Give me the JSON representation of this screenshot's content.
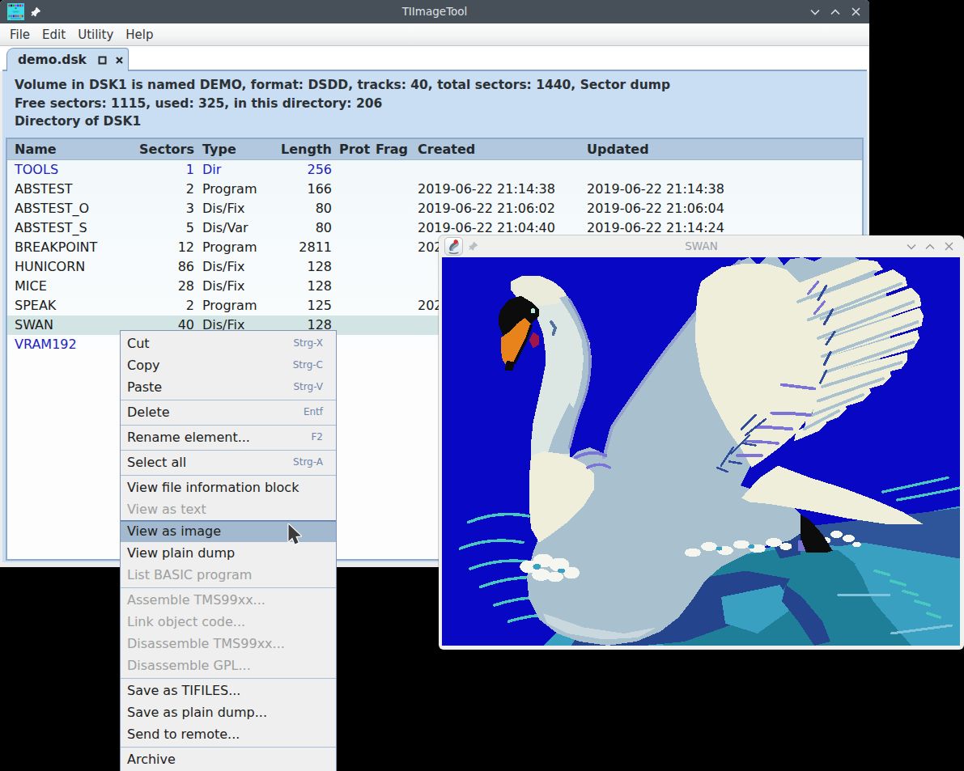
{
  "desktop": {
    "background": "#000000"
  },
  "main_window": {
    "title": "TIImageTool",
    "titlebar_controls": {
      "minimize": "v-chevron",
      "maximize": "^-chevron",
      "close": "x"
    },
    "menubar": {
      "items": [
        "File",
        "Edit",
        "Utility",
        "Help"
      ]
    },
    "tab": {
      "label": "demo.dsk",
      "detach_icon": "square-outline",
      "close_icon": "x"
    },
    "info_lines": [
      "Volume in DSK1 is named DEMO, format: DSDD, tracks: 40, total sectors: 1440, Sector dump",
      "Free sectors: 1115, used: 325, in this directory: 206",
      "Directory of DSK1"
    ],
    "table": {
      "columns": [
        "Name",
        "Sectors",
        "Type",
        "Length",
        "Prot",
        "Frag",
        "Created",
        "Updated"
      ],
      "rows": [
        {
          "name": "TOOLS",
          "sectors": "1",
          "type": "Dir",
          "length": "256",
          "prot": "",
          "frag": "",
          "created": "",
          "updated": "",
          "dir": true,
          "selected": false
        },
        {
          "name": "ABSTEST",
          "sectors": "2",
          "type": "Program",
          "length": "166",
          "prot": "",
          "frag": "",
          "created": "2019-06-22 21:14:38",
          "updated": "2019-06-22 21:14:38",
          "dir": false,
          "selected": false
        },
        {
          "name": "ABSTEST_O",
          "sectors": "3",
          "type": "Dis/Fix",
          "length": "80",
          "prot": "",
          "frag": "",
          "created": "2019-06-22 21:06:02",
          "updated": "2019-06-22 21:06:04",
          "dir": false,
          "selected": false
        },
        {
          "name": "ABSTEST_S",
          "sectors": "5",
          "type": "Dis/Var",
          "length": "80",
          "prot": "",
          "frag": "",
          "created": "2019-06-22 21:04:40",
          "updated": "2019-06-22 21:14:24",
          "dir": false,
          "selected": false
        },
        {
          "name": "BREAKPOINT",
          "sectors": "12",
          "type": "Program",
          "length": "2811",
          "prot": "",
          "frag": "",
          "created": "202",
          "updated": "",
          "dir": false,
          "selected": false
        },
        {
          "name": "HUNICORN",
          "sectors": "86",
          "type": "Dis/Fix",
          "length": "128",
          "prot": "",
          "frag": "",
          "created": "",
          "updated": "",
          "dir": false,
          "selected": false
        },
        {
          "name": "MICE",
          "sectors": "28",
          "type": "Dis/Fix",
          "length": "128",
          "prot": "",
          "frag": "",
          "created": "",
          "updated": "",
          "dir": false,
          "selected": false
        },
        {
          "name": "SPEAK",
          "sectors": "2",
          "type": "Program",
          "length": "125",
          "prot": "",
          "frag": "",
          "created": "202",
          "updated": "",
          "dir": false,
          "selected": false
        },
        {
          "name": "SWAN",
          "sectors": "40",
          "type": "Dis/Fix",
          "length": "128",
          "prot": "",
          "frag": "",
          "created": "",
          "updated": "",
          "dir": false,
          "selected": true
        },
        {
          "name": "VRAM192",
          "sectors": "",
          "type": "",
          "length": "",
          "prot": "",
          "frag": "",
          "created": "",
          "updated": "",
          "dir": true,
          "selected": false
        }
      ]
    }
  },
  "context_menu": {
    "items": [
      {
        "label": "Cut",
        "shortcut": "Strg-X"
      },
      {
        "label": "Copy",
        "shortcut": "Strg-C"
      },
      {
        "label": "Paste",
        "shortcut": "Strg-V"
      },
      {
        "separator": true
      },
      {
        "label": "Delete",
        "shortcut": "Entf"
      },
      {
        "separator": true
      },
      {
        "label": "Rename element...",
        "shortcut": "F2"
      },
      {
        "separator": true
      },
      {
        "label": "Select all",
        "shortcut": "Strg-A"
      },
      {
        "separator": true
      },
      {
        "label": "View file information block"
      },
      {
        "label": "View as text",
        "disabled": true
      },
      {
        "label": "View as image",
        "highlighted": true
      },
      {
        "label": "View plain dump"
      },
      {
        "label": "List BASIC program",
        "disabled": true
      },
      {
        "separator": true
      },
      {
        "label": "Assemble TMS99xx...",
        "disabled": true
      },
      {
        "label": "Link object code...",
        "disabled": true
      },
      {
        "label": "Disassemble TMS99xx...",
        "disabled": true
      },
      {
        "label": "Disassemble GPL...",
        "disabled": true
      },
      {
        "separator": true
      },
      {
        "label": "Save as TIFILES..."
      },
      {
        "label": "Save as plain dump..."
      },
      {
        "label": "Send to remote..."
      },
      {
        "separator": true
      },
      {
        "label": "Archive"
      }
    ]
  },
  "image_window": {
    "title": "SWAN",
    "image_name": "swan-pixel-art",
    "palette": {
      "background": "#0707C4",
      "cream": "#EFEEDA",
      "bodyGray": "#A9C1CF",
      "edgeGray": "#97A3CE",
      "shadeGray": "#93AFC5",
      "violet": "#7B74D6",
      "navyLine": "#2F4B9B",
      "black": "#0C0C0C",
      "orange": "#E8821A",
      "red": "#A01648",
      "teal": "#3AA0C2",
      "slate": "#2E5499",
      "navy": "#24448E",
      "cyan": "#49C8C0",
      "paleCyan": "#7FC4DC",
      "foam": "#F4F6EF",
      "belly": "#C9D8DF",
      "darkTeal": "#1F7E98",
      "neckPale": "#DCE7E3",
      "crownCream": "#EAEBDA",
      "periwinkle": "#8C96CC",
      "chinShadow": "#50709E",
      "eye": "#BFE8E0"
    }
  },
  "cursor": {
    "type": "arrow"
  }
}
